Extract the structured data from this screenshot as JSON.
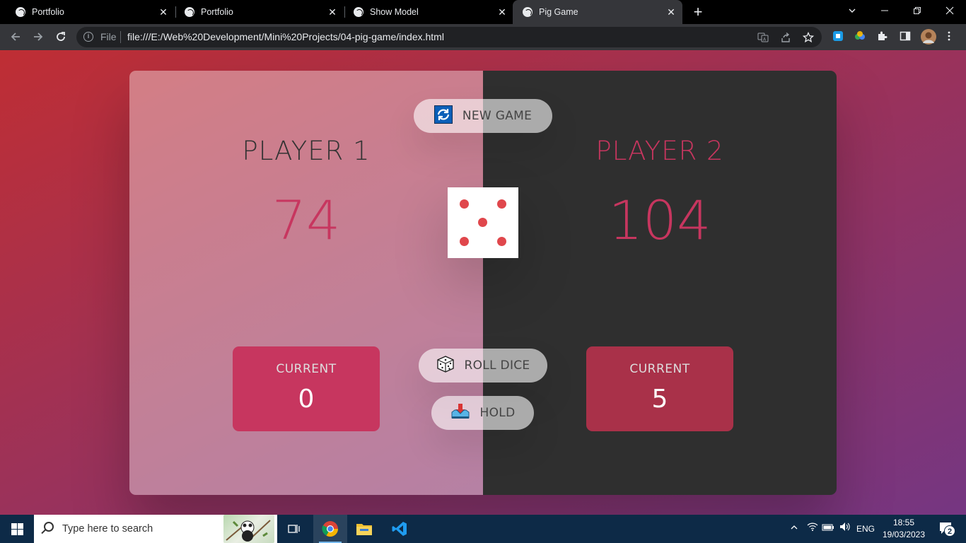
{
  "browser": {
    "tabs": [
      {
        "title": "Portfolio",
        "active": false
      },
      {
        "title": "Portfolio",
        "active": false
      },
      {
        "title": "Show Model",
        "active": false
      },
      {
        "title": "Pig Game",
        "active": true
      }
    ],
    "new_tab_glyph": "+",
    "close_glyph": "✕",
    "address": {
      "scheme_label": "File",
      "url": "file:///E:/Web%20Development/Mini%20Projects/04-pig-game/index.html"
    }
  },
  "game": {
    "players": [
      {
        "name": "PLAYER 1",
        "score": "74",
        "current_label": "CURRENT",
        "current": "0",
        "active": false
      },
      {
        "name": "PLAYER 2",
        "score": "104",
        "current_label": "CURRENT",
        "current": "5",
        "active": true
      }
    ],
    "buttons": {
      "new_game": "NEW GAME",
      "roll_dice": "ROLL DICE",
      "hold": "HOLD"
    },
    "dice_value": 5,
    "colors": {
      "accent": "#c7365f",
      "dice_pip": "#e0474c",
      "dark_panel": "#2f2f2f",
      "bg_from": "#bf2e34",
      "bg_to": "#753682"
    }
  },
  "taskbar": {
    "search_placeholder": "Type here to search",
    "language": "ENG",
    "time": "18:55",
    "date": "19/03/2023",
    "notification_count": "2"
  }
}
